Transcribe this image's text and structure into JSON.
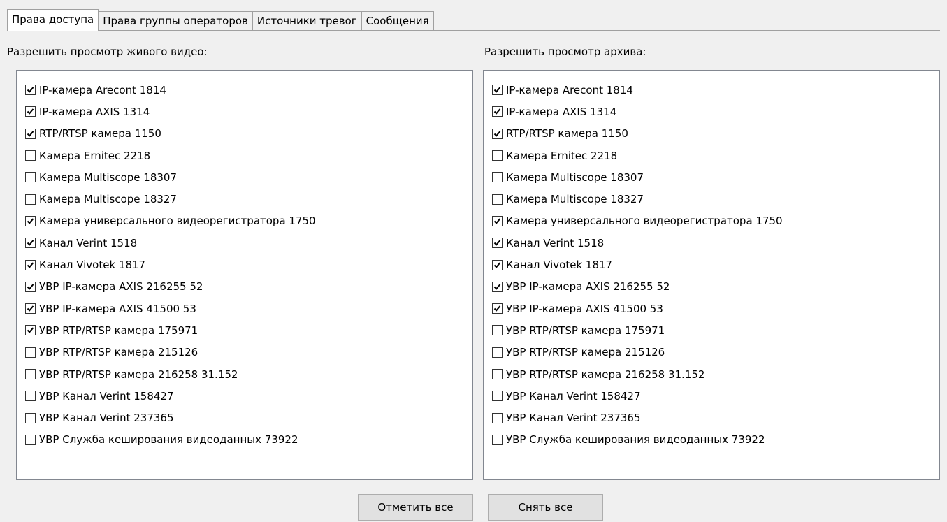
{
  "tabs": [
    {
      "label": "Права доступа",
      "active": true
    },
    {
      "label": "Права группы операторов",
      "active": false
    },
    {
      "label": "Источники тревог",
      "active": false
    },
    {
      "label": "Сообщения",
      "active": false
    }
  ],
  "live": {
    "label": "Разрешить просмотр живого видео:",
    "items": [
      {
        "label": "IP-камера Arecont 1814",
        "checked": true
      },
      {
        "label": "IP-камера AXIS 1314",
        "checked": true
      },
      {
        "label": "RTP/RTSP камера 1150",
        "checked": true
      },
      {
        "label": "Камера Ernitec 2218",
        "checked": false
      },
      {
        "label": "Камера Multiscope 18307",
        "checked": false
      },
      {
        "label": "Камера Multiscope 18327",
        "checked": false
      },
      {
        "label": "Камера универсального видеорегистратора 1750",
        "checked": true
      },
      {
        "label": "Канал Verint 1518",
        "checked": true
      },
      {
        "label": "Канал Vivotek 1817",
        "checked": true
      },
      {
        "label": "УВР IP-камера AXIS 216255 52",
        "checked": true
      },
      {
        "label": "УВР IP-камера AXIS 41500 53",
        "checked": true
      },
      {
        "label": "УВР RTP/RTSP камера 175971",
        "checked": true
      },
      {
        "label": "УВР RTP/RTSP камера 215126",
        "checked": false
      },
      {
        "label": "УВР RTP/RTSP камера 216258 31.152",
        "checked": false
      },
      {
        "label": "УВР Канал Verint 158427",
        "checked": false
      },
      {
        "label": "УВР Канал Verint 237365",
        "checked": false
      },
      {
        "label": "УВР Служба кеширования видеоданных 73922",
        "checked": false
      }
    ]
  },
  "archive": {
    "label": "Разрешить просмотр архива:",
    "items": [
      {
        "label": "IP-камера Arecont 1814",
        "checked": true
      },
      {
        "label": "IP-камера AXIS 1314",
        "checked": true
      },
      {
        "label": "RTP/RTSP камера 1150",
        "checked": true
      },
      {
        "label": "Камера Ernitec 2218",
        "checked": false
      },
      {
        "label": "Камера Multiscope 18307",
        "checked": false
      },
      {
        "label": "Камера Multiscope 18327",
        "checked": false
      },
      {
        "label": "Камера универсального видеорегистратора 1750",
        "checked": true
      },
      {
        "label": "Канал Verint 1518",
        "checked": true
      },
      {
        "label": "Канал Vivotek 1817",
        "checked": true
      },
      {
        "label": "УВР IP-камера AXIS 216255 52",
        "checked": true
      },
      {
        "label": "УВР IP-камера AXIS 41500 53",
        "checked": true
      },
      {
        "label": "УВР RTP/RTSP камера 175971",
        "checked": false
      },
      {
        "label": "УВР RTP/RTSP камера 215126",
        "checked": false
      },
      {
        "label": "УВР RTP/RTSP камера 216258 31.152",
        "checked": false
      },
      {
        "label": "УВР Канал Verint 158427",
        "checked": false
      },
      {
        "label": "УВР Канал Verint 237365",
        "checked": false
      },
      {
        "label": "УВР Служба кеширования видеоданных 73922",
        "checked": false
      }
    ]
  },
  "buttons": {
    "check_all": "Отметить все",
    "uncheck_all": "Снять все"
  }
}
